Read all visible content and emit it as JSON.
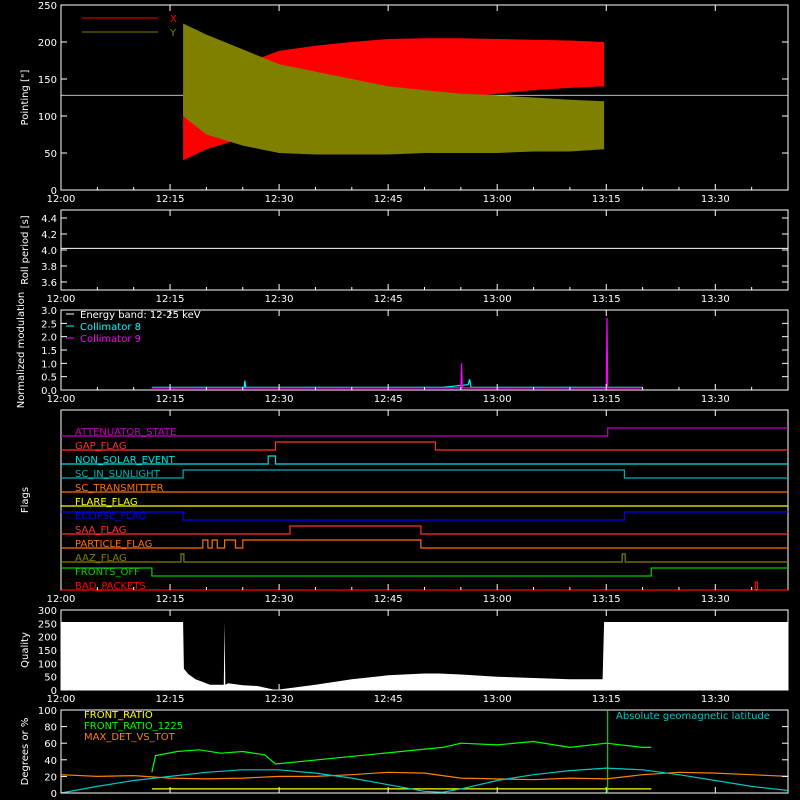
{
  "colors": {
    "background": "#000000",
    "axes": "#ffffff",
    "x_series": "#ff0000",
    "y_series": "#808000",
    "collimator8": "#00ffff",
    "collimator9": "#ff00ff",
    "front_ratio": "#ffff00",
    "front_ratio_1225": "#00ff00",
    "max_det": "#ff8000",
    "geomag": "#00c8c8"
  },
  "time_axis": {
    "range_minutes": [
      0,
      100
    ],
    "ticks": [
      "12:00",
      "12:15",
      "12:30",
      "12:45",
      "13:00",
      "13:15",
      "13:30"
    ],
    "tick_minutes": [
      0,
      15,
      30,
      45,
      60,
      75,
      90
    ]
  },
  "chart_data": [
    {
      "type": "area",
      "id": "pointing",
      "ylabel": "Pointing [\"]",
      "ylim": [
        0,
        250
      ],
      "yticks": [
        "0",
        "50",
        "100",
        "150",
        "200",
        "250"
      ],
      "ytick_values": [
        0,
        50,
        100,
        150,
        200,
        250
      ],
      "reference_level": 128,
      "series": [
        {
          "name": "X",
          "x": [
            16.8,
            20,
            25,
            30,
            35,
            40,
            45,
            50,
            55,
            60,
            65,
            70,
            74.7
          ],
          "upper": [
            130,
            150,
            170,
            188,
            195,
            200,
            204,
            205,
            205,
            204,
            203,
            202,
            200
          ],
          "lower": [
            40,
            55,
            70,
            85,
            95,
            105,
            115,
            120,
            125,
            130,
            135,
            138,
            140
          ]
        },
        {
          "name": "Y",
          "x": [
            16.8,
            20,
            25,
            30,
            35,
            40,
            45,
            50,
            55,
            60,
            65,
            70,
            74.7
          ],
          "upper": [
            225,
            210,
            190,
            170,
            160,
            150,
            140,
            135,
            130,
            128,
            125,
            122,
            120
          ],
          "lower": [
            100,
            75,
            60,
            50,
            48,
            48,
            48,
            50,
            50,
            50,
            52,
            52,
            55
          ]
        }
      ]
    },
    {
      "type": "line",
      "id": "roll-period",
      "ylabel": "Roll period [s]",
      "ylim": [
        3.5,
        4.5
      ],
      "yticks": [
        "3.6",
        "3.8",
        "4.0",
        "4.2",
        "4.4"
      ],
      "ytick_values": [
        3.6,
        3.8,
        4.0,
        4.2,
        4.4
      ],
      "series": [
        {
          "name": "",
          "x": [
            0,
            100
          ],
          "y": [
            4.02,
            4.02
          ]
        }
      ]
    },
    {
      "type": "line",
      "id": "modulation",
      "ylabel": "Normalized modulation",
      "ylim": [
        0,
        3
      ],
      "yticks": [
        "0.0",
        "0.5",
        "1.0",
        "1.5",
        "2.0",
        "2.5",
        "3.0"
      ],
      "ytick_values": [
        0,
        0.5,
        1,
        1.5,
        2,
        2.5,
        3
      ],
      "legend": [
        "Energy band: 12-25 keV",
        "Collimator 8",
        "Collimator 9"
      ],
      "series": [
        {
          "name": "Collimator 8",
          "x": [
            12.5,
            21.5,
            25.2,
            25.3,
            25.4,
            29.5,
            52.5,
            56,
            56.2,
            56.4,
            65,
            70,
            75.3,
            80
          ],
          "y": [
            0.1,
            0.1,
            0.1,
            0.35,
            0.1,
            0.1,
            0.1,
            0.2,
            0.4,
            0.1,
            0.1,
            0.1,
            0.1,
            0.1
          ]
        },
        {
          "name": "Collimator 9",
          "x": [
            12.5,
            16,
            29.5,
            52.5,
            55,
            55.1,
            55.2,
            60,
            70,
            75,
            75.1,
            75.2,
            80
          ],
          "y": [
            0.08,
            0.08,
            0.08,
            0.08,
            0.08,
            1.0,
            0.08,
            0.08,
            0.08,
            0.08,
            2.7,
            0.08,
            0.08
          ]
        }
      ]
    },
    {
      "type": "line",
      "id": "flags",
      "ylabel": "Flags",
      "series": [
        {
          "name": "ATTENUATOR_STATE",
          "color": "#c000c0",
          "steps": [
            [
              0,
              0
            ],
            [
              75.2,
              1
            ],
            [
              100,
              1
            ]
          ]
        },
        {
          "name": "GAP_FLAG",
          "color": "#ff3030",
          "steps": [
            [
              0,
              0
            ],
            [
              29.5,
              1
            ],
            [
              51.5,
              0
            ],
            [
              100,
              0
            ]
          ]
        },
        {
          "name": "NON_SOLAR_EVENT",
          "color": "#00e0e0",
          "steps": [
            [
              0,
              0
            ],
            [
              28.5,
              1
            ],
            [
              29.5,
              0
            ],
            [
              100,
              0
            ]
          ]
        },
        {
          "name": "SC_IN_SUNLIGHT",
          "color": "#00b0b0",
          "steps": [
            [
              0,
              0
            ],
            [
              16.8,
              1
            ],
            [
              77.5,
              0
            ],
            [
              100,
              0
            ]
          ]
        },
        {
          "name": "SC_TRANSMITTER",
          "color": "#ff7000",
          "steps": [
            [
              0,
              0
            ],
            [
              100,
              0
            ]
          ]
        },
        {
          "name": "FLARE_FLAG",
          "color": "#ffff00",
          "steps": [
            [
              0,
              0
            ],
            [
              100,
              0
            ]
          ]
        },
        {
          "name": "ECLIPSE_FLAG",
          "color": "#0000ff",
          "steps": [
            [
              0,
              1
            ],
            [
              16.8,
              0
            ],
            [
              77.5,
              1
            ],
            [
              100,
              1
            ]
          ]
        },
        {
          "name": "SAA_FLAG",
          "color": "#ff3030",
          "steps": [
            [
              0,
              0
            ],
            [
              31.5,
              1
            ],
            [
              49.5,
              0
            ],
            [
              100,
              0
            ]
          ]
        },
        {
          "name": "PARTICLE_FLAG",
          "color": "#ff7000",
          "steps": [
            [
              0,
              0
            ],
            [
              19.5,
              1
            ],
            [
              20.2,
              0
            ],
            [
              20.8,
              1
            ],
            [
              21.5,
              0
            ],
            [
              22.5,
              1
            ],
            [
              24,
              0
            ],
            [
              25,
              1
            ],
            [
              49.5,
              0
            ],
            [
              100,
              0
            ]
          ]
        },
        {
          "name": "AAZ_FLAG",
          "color": "#808000",
          "steps": [
            [
              0,
              0
            ],
            [
              16.5,
              1
            ],
            [
              16.9,
              0
            ],
            [
              77.2,
              1
            ],
            [
              77.6,
              0
            ],
            [
              100,
              0
            ]
          ]
        },
        {
          "name": "FRONTS_OFF",
          "color": "#00d000",
          "steps": [
            [
              0,
              1
            ],
            [
              12.5,
              0
            ],
            [
              81.2,
              1
            ],
            [
              100,
              1
            ]
          ]
        },
        {
          "name": "BAD_PACKETS",
          "color": "#ff0000",
          "steps": [
            [
              0,
              0
            ],
            [
              95.5,
              1
            ],
            [
              95.8,
              0
            ],
            [
              100,
              0
            ]
          ]
        }
      ]
    },
    {
      "type": "area",
      "id": "quality",
      "ylabel": "Quality",
      "ylim": [
        0,
        300
      ],
      "yticks": [
        "0",
        "50",
        "100",
        "150",
        "200",
        "250",
        "300"
      ],
      "ytick_values": [
        0,
        50,
        100,
        150,
        200,
        250,
        300
      ],
      "series": [
        {
          "name": "",
          "x": [
            0,
            16.8,
            16.9,
            17.5,
            18.5,
            19.5,
            20.5,
            21.5,
            22.4,
            22.5,
            22.6,
            23,
            25,
            27,
            29.5,
            35,
            40,
            45,
            50,
            52,
            55,
            60,
            65,
            70,
            74.5,
            74.7,
            100
          ],
          "y": [
            255,
            255,
            80,
            60,
            40,
            30,
            20,
            20,
            20,
            255,
            20,
            25,
            18,
            15,
            0,
            20,
            40,
            55,
            62,
            62,
            58,
            50,
            45,
            40,
            40,
            255,
            255
          ]
        }
      ]
    },
    {
      "type": "line",
      "id": "degrees",
      "ylabel": "Degrees or %",
      "ylim": [
        0,
        100
      ],
      "yticks": [
        "0",
        "20",
        "40",
        "60",
        "80",
        "100"
      ],
      "ytick_values": [
        0,
        20,
        40,
        60,
        80,
        100
      ],
      "legend": [
        "FRONT_RATIO",
        "FRONT_RATIO_1225",
        "MAX_DET_VS_TOT"
      ],
      "annotation": "Absolute geomagnetic latitude",
      "series": [
        {
          "name": "FRONT_RATIO_1225",
          "x": [
            12.5,
            13,
            16,
            19,
            22,
            25,
            28,
            29.5,
            52.5,
            55,
            60,
            65,
            70,
            75,
            80,
            81.2
          ],
          "y": [
            25,
            45,
            50,
            52,
            48,
            50,
            46,
            35,
            55,
            60,
            58,
            62,
            55,
            60,
            55,
            55
          ]
        },
        {
          "name": "FRONT_RATIO",
          "x": [
            12.5,
            29.5,
            52.5,
            81.2
          ],
          "y": [
            5,
            5,
            5,
            5
          ]
        },
        {
          "name": "MAX_DET_VS_TOT",
          "x": [
            0,
            5,
            10,
            15,
            20,
            25,
            30,
            35,
            40,
            45,
            50,
            55,
            60,
            65,
            70,
            75,
            80,
            85,
            90,
            95,
            100
          ],
          "y": [
            22,
            20,
            21,
            18,
            17,
            18,
            20,
            20,
            22,
            25,
            24,
            18,
            17,
            16,
            18,
            17,
            22,
            25,
            24,
            22,
            20
          ]
        },
        {
          "name": "Absolute geomagnetic latitude",
          "x": [
            0,
            5,
            10,
            15,
            20,
            25,
            30,
            35,
            40,
            45,
            50,
            52.5,
            55,
            60,
            65,
            70,
            75,
            80,
            85,
            90,
            95,
            100
          ],
          "y": [
            0,
            8,
            15,
            20,
            25,
            28,
            28,
            24,
            18,
            10,
            2,
            1,
            5,
            15,
            22,
            27,
            30,
            28,
            22,
            15,
            8,
            3
          ]
        }
      ]
    }
  ]
}
